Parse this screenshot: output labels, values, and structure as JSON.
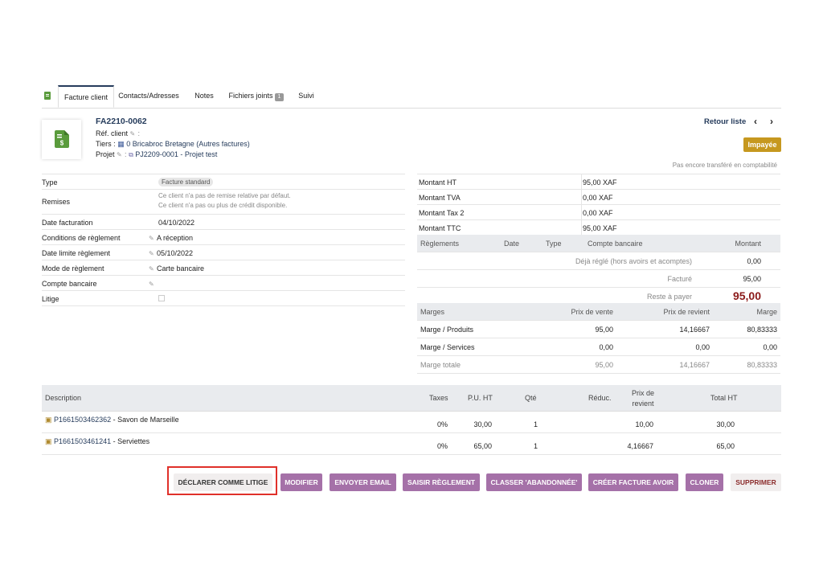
{
  "tabs": [
    {
      "label": "Facture client"
    },
    {
      "label": "Contacts/Adresses"
    },
    {
      "label": "Notes"
    },
    {
      "label": "Fichiers joints",
      "badge": "1"
    },
    {
      "label": "Suivi"
    }
  ],
  "header": {
    "ref": "FA2210-0062",
    "ref_client_label": "Réf. client",
    "tiers_label": "Tiers :",
    "tiers_value": "0 Bricabroc Bretagne (Autres factures)",
    "projet_label": "Projet",
    "projet_value": "PJ2209-0001 - Projet test",
    "retour_liste": "Retour liste",
    "status": "Impayée",
    "compta_note": "Pas encore transféré en comptabilité"
  },
  "details": {
    "type_label": "Type",
    "type_value": "Facture standard",
    "remises_label": "Remises",
    "remises_line1": "Ce client n'a pas de remise relative par défaut.",
    "remises_line2": "Ce client n'a pas ou plus de crédit disponible.",
    "date_fact_label": "Date facturation",
    "date_fact_value": "04/10/2022",
    "cond_label": "Conditions de règlement",
    "cond_value": "A réception",
    "date_lim_label": "Date limite règlement",
    "date_lim_value": "05/10/2022",
    "mode_label": "Mode de règlement",
    "mode_value": "Carte bancaire",
    "compte_label": "Compte bancaire",
    "litige_label": "Litige"
  },
  "amounts": {
    "ht_label": "Montant HT",
    "ht_value": "95,00 XAF",
    "tva_label": "Montant TVA",
    "tva_value": "0,00 XAF",
    "tax2_label": "Montant Tax 2",
    "tax2_value": "0,00 XAF",
    "ttc_label": "Montant TTC",
    "ttc_value": "95,00 XAF"
  },
  "payments": {
    "h_reglements": "Règlements",
    "h_date": "Date",
    "h_type": "Type",
    "h_compte": "Compte bancaire",
    "h_montant": "Montant",
    "deja_label": "Déjà réglé (hors avoirs et acomptes)",
    "deja_value": "0,00",
    "facture_label": "Facturé",
    "facture_value": "95,00",
    "reste_label": "Reste à payer",
    "reste_value": "95,00"
  },
  "margins": {
    "h_marges": "Marges",
    "h_pv": "Prix de vente",
    "h_pr": "Prix de revient",
    "h_marge": "Marge",
    "rows": [
      {
        "label": "Marge / Produits",
        "pv": "95,00",
        "pr": "14,16667",
        "m": "80,83333"
      },
      {
        "label": "Marge / Services",
        "pv": "0,00",
        "pr": "0,00",
        "m": "0,00"
      },
      {
        "label": "Marge totale",
        "pv": "95,00",
        "pr": "14,16667",
        "m": "80,83333"
      }
    ]
  },
  "lines": {
    "h_desc": "Description",
    "h_taxes": "Taxes",
    "h_pu": "P.U. HT",
    "h_qte": "Qté",
    "h_reduc": "Réduc.",
    "h_pr_1": "Prix de",
    "h_pr_2": "revient",
    "h_total": "Total HT",
    "rows": [
      {
        "ref": "P1661503462362",
        "label": " - Savon de Marseille",
        "taxes": "0%",
        "pu": "30,00",
        "qte": "1",
        "pr": "10,00",
        "total": "30,00"
      },
      {
        "ref": "P1661503461241",
        "label": " - Serviettes",
        "taxes": "0%",
        "pu": "65,00",
        "qte": "1",
        "pr": "4,16667",
        "total": "65,00"
      }
    ]
  },
  "actions": {
    "litige": "DÉCLARER COMME LITIGE",
    "modifier": "MODIFIER",
    "email": "ENVOYER EMAIL",
    "reglement": "SAISIR RÈGLEMENT",
    "abandon": "CLASSER 'ABANDONNÉE'",
    "avoir": "CRÉER FACTURE AVOIR",
    "cloner": "CLONER",
    "supprimer": "SUPPRIMER"
  },
  "colors": {
    "accent": "#a571a8",
    "title": "#263c5c",
    "status": "#c6981f",
    "reste": "#8b1a1a",
    "highlight": "#e0302a"
  }
}
